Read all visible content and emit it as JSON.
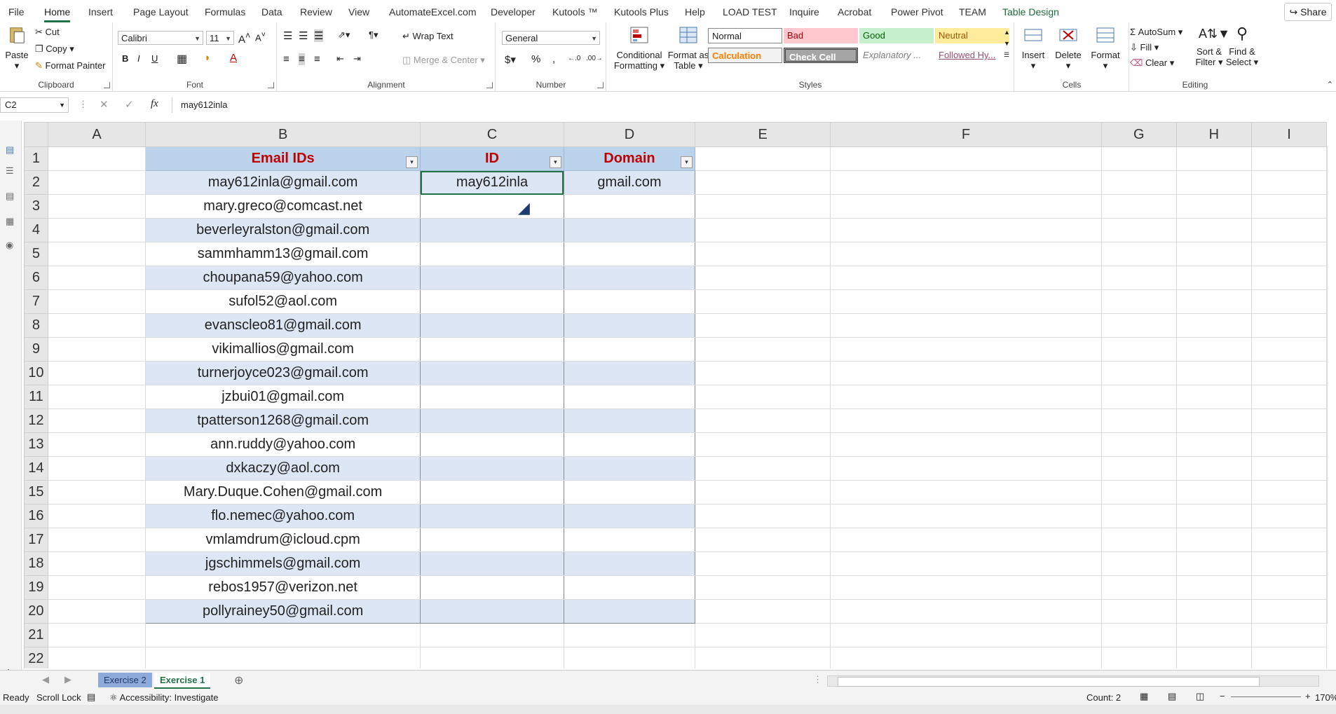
{
  "ribbon_tabs": [
    "File",
    "Home",
    "Insert",
    "Page Layout",
    "Formulas",
    "Data",
    "Review",
    "View",
    "AutomateExcel.com",
    "Developer",
    "Kutools ™",
    "Kutools Plus",
    "Help",
    "LOAD TEST",
    "Inquire",
    "Acrobat",
    "Power Pivot",
    "TEAM",
    "Table Design"
  ],
  "share_label": "Share",
  "clipboard": {
    "paste": "Paste",
    "cut": "Cut",
    "copy": "Copy",
    "format_painter": "Format Painter",
    "group": "Clipboard"
  },
  "font": {
    "name": "Calibri",
    "size": "11",
    "group": "Font"
  },
  "alignment": {
    "wrap": "Wrap Text",
    "merge": "Merge & Center",
    "group": "Alignment"
  },
  "number": {
    "format": "General",
    "group": "Number"
  },
  "styles": {
    "conditional": "Conditional Formatting",
    "format_table": "Format as Table",
    "normal": "Normal",
    "bad": "Bad",
    "good": "Good",
    "neutral": "Neutral",
    "calculation": "Calculation",
    "check_cell": "Check Cell",
    "explanatory": "Explanatory ...",
    "followed": "Followed Hy...",
    "group": "Styles"
  },
  "cells": {
    "insert": "Insert",
    "delete": "Delete",
    "format": "Format",
    "group": "Cells"
  },
  "editing": {
    "autosum": "AutoSum",
    "fill": "Fill",
    "clear": "Clear",
    "sort": "Sort & Filter",
    "find": "Find & Select",
    "group": "Editing"
  },
  "formula_bar": {
    "name_box": "C2",
    "fx": "fx",
    "value": "may612inla"
  },
  "columns": [
    "A",
    "B",
    "C",
    "D",
    "E",
    "F",
    "G",
    "H",
    "I"
  ],
  "table": {
    "headers": [
      "Email IDs",
      "ID",
      "Domain"
    ],
    "rows": [
      {
        "email": "may612inla@gmail.com",
        "id": "may612inla",
        "domain": "gmail.com"
      },
      {
        "email": "mary.greco@comcast.net",
        "id": "",
        "domain": ""
      },
      {
        "email": "beverleyralston@gmail.com",
        "id": "",
        "domain": ""
      },
      {
        "email": "sammhamm13@gmail.com",
        "id": "",
        "domain": ""
      },
      {
        "email": "choupana59@yahoo.com",
        "id": "",
        "domain": ""
      },
      {
        "email": "sufol52@aol.com",
        "id": "",
        "domain": ""
      },
      {
        "email": "evanscleo81@gmail.com",
        "id": "",
        "domain": ""
      },
      {
        "email": "vikimallios@gmail.com",
        "id": "",
        "domain": ""
      },
      {
        "email": "turnerjoyce023@gmail.com",
        "id": "",
        "domain": ""
      },
      {
        "email": "jzbui01@gmail.com",
        "id": "",
        "domain": ""
      },
      {
        "email": "tpatterson1268@gmail.com",
        "id": "",
        "domain": ""
      },
      {
        "email": "ann.ruddy@yahoo.com",
        "id": "",
        "domain": ""
      },
      {
        "email": "dxkaczy@aol.com",
        "id": "",
        "domain": ""
      },
      {
        "email": "Mary.Duque.Cohen@gmail.com",
        "id": "",
        "domain": ""
      },
      {
        "email": "flo.nemec@yahoo.com",
        "id": "",
        "domain": ""
      },
      {
        "email": "vmlamdrum@icloud.cpm",
        "id": "",
        "domain": ""
      },
      {
        "email": "jgschimmels@gmail.com",
        "id": "",
        "domain": ""
      },
      {
        "email": "rebos1957@verizon.net",
        "id": "",
        "domain": ""
      },
      {
        "email": "pollyrainey50@gmail.com",
        "id": "",
        "domain": ""
      }
    ]
  },
  "sheets": [
    "Exercise 2",
    "Exercise 1"
  ],
  "active_sheet": "Exercise 1",
  "status": {
    "ready": "Ready",
    "scroll_lock": "Scroll Lock",
    "accessibility": "Accessibility: Investigate",
    "count": "Count: 2",
    "zoom": "170%"
  },
  "colors": {
    "accent": "#217346",
    "header_fill": "#bcd3ec",
    "header_text": "#c00000",
    "band_fill": "#dde6f4"
  }
}
